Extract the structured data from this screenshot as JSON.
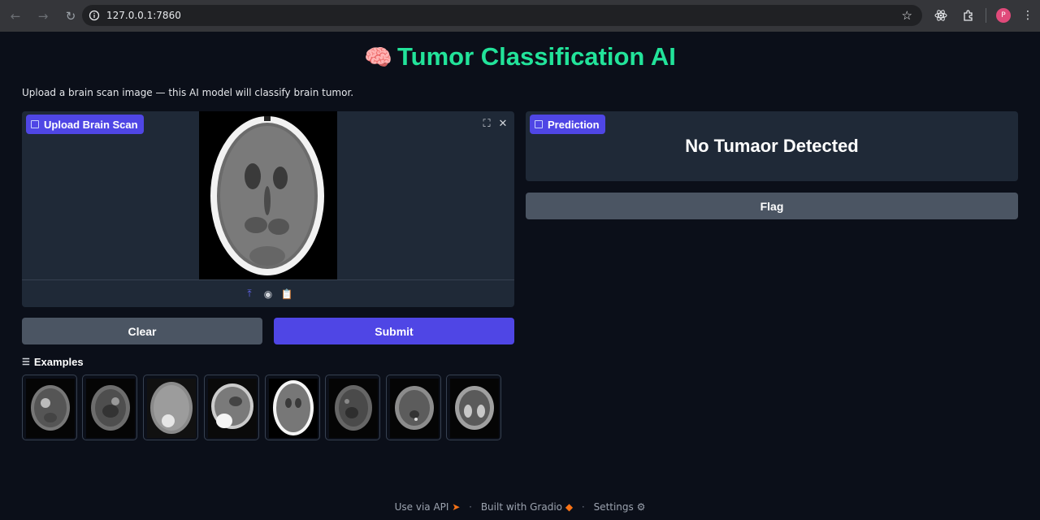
{
  "browser": {
    "url": "127.0.0.1:7860"
  },
  "app": {
    "title": "Tumor Classification AI",
    "title_icon": "brain-emoji",
    "description": "Upload a brain scan image — this AI model will classify brain tumor.",
    "accent_color": "#22e39a",
    "primary_color": "#4f46e5"
  },
  "input": {
    "label": "Upload Brain Scan",
    "image_description": "axial brain CT scan"
  },
  "buttons": {
    "clear": "Clear",
    "submit": "Submit",
    "flag": "Flag"
  },
  "examples": {
    "label": "Examples",
    "count": 8
  },
  "output": {
    "label": "Prediction",
    "value": "No Tumaor Detected"
  },
  "footer": {
    "api": "Use via API",
    "built": "Built with Gradio",
    "settings": "Settings"
  }
}
